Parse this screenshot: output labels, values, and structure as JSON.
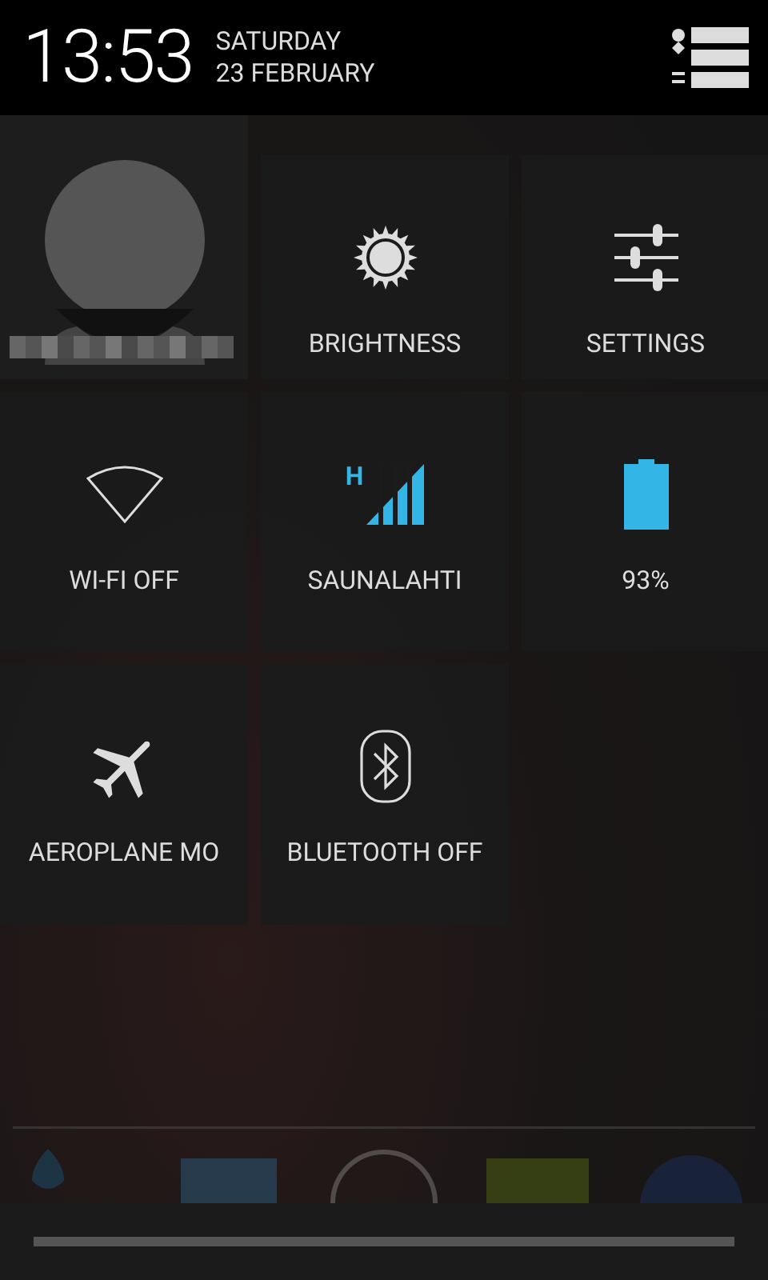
{
  "header": {
    "time": "13:53",
    "day": "SATURDAY",
    "date": "23 FEBRUARY"
  },
  "tiles": [
    {
      "kind": "user"
    },
    {
      "kind": "brightness",
      "label": "BRIGHTNESS"
    },
    {
      "kind": "settings",
      "label": "SETTINGS"
    },
    {
      "kind": "wifi",
      "label": "WI-FI OFF",
      "on": false
    },
    {
      "kind": "signal",
      "label": "SAUNALAHTI",
      "network": "H"
    },
    {
      "kind": "battery",
      "label": "93%"
    },
    {
      "kind": "airplane",
      "label": "AEROPLANE MO"
    },
    {
      "kind": "bluetooth",
      "label": "BLUETOOTH OFF",
      "on": false
    }
  ]
}
